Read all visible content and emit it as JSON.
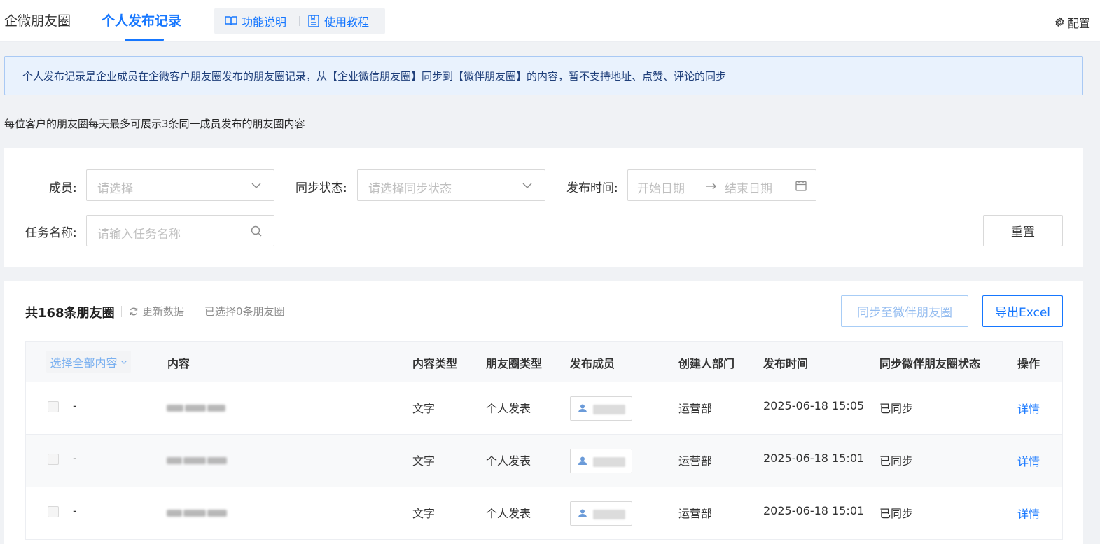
{
  "header": {
    "tabs": [
      "企微朋友圈",
      "个人发布记录"
    ],
    "help_links": [
      "功能说明",
      "使用教程"
    ],
    "config_label": "配置"
  },
  "notice": "个人发布记录是企业成员在企微客户朋友圈发布的朋友圈记录，从【企业微信朋友圈】同步到【微伴朋友圈】的内容，暂不支持地址、点赞、评论的同步",
  "sub_note": "每位客户的朋友圈每天最多可展示3条同一成员发布的朋友圈内容",
  "filters": {
    "member_label": "成员:",
    "member_placeholder": "请选择",
    "sync_label": "同步状态:",
    "sync_placeholder": "请选择同步状态",
    "time_label": "发布时间:",
    "start_placeholder": "开始日期",
    "end_placeholder": "结束日期",
    "task_label": "任务名称:",
    "task_placeholder": "请输入任务名称",
    "reset_label": "重置"
  },
  "list": {
    "count_title": "共168条朋友圈",
    "refresh_label": "更新数据",
    "selected_count": "已选择0条朋友圈",
    "sync_button": "同步至微伴朋友圈",
    "export_button": "导出Excel"
  },
  "table": {
    "select_all": "选择全部内容",
    "headers": [
      "内容",
      "内容类型",
      "朋友圈类型",
      "发布成员",
      "创建人部门",
      "发布时间",
      "同步微伴朋友圈状态",
      "操作"
    ],
    "rows": [
      {
        "dash": "-",
        "content_type": "文字",
        "moment_type": "个人发表",
        "dept": "运营部",
        "time": "2025-06-18 15:05",
        "status": "已同步",
        "action": "详情"
      },
      {
        "dash": "-",
        "content_type": "文字",
        "moment_type": "个人发表",
        "dept": "运营部",
        "time": "2025-06-18 15:01",
        "status": "已同步",
        "action": "详情"
      },
      {
        "dash": "-",
        "content_type": "文字",
        "moment_type": "个人发表",
        "dept": "运营部",
        "time": "2025-06-18 15:01",
        "status": "已同步",
        "action": "详情"
      }
    ]
  },
  "colors": {
    "primary": "#1677ff",
    "notice_bg": "#e9f2fd",
    "page_bg": "#f0f2f5"
  }
}
